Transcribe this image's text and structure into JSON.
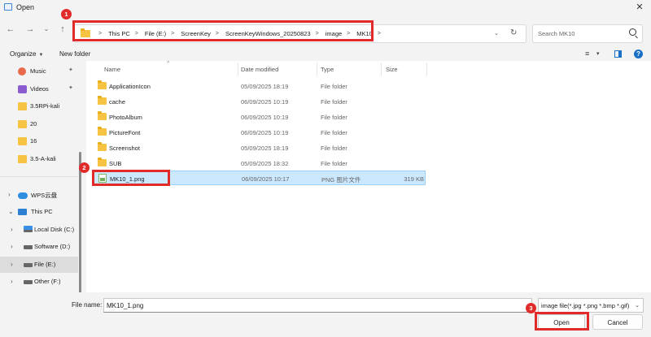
{
  "window": {
    "title": "Open",
    "close_glyph": "✕"
  },
  "nav": {
    "back_glyph": "←",
    "forward_glyph": "→",
    "dropdown_glyph": "⌄",
    "up_glyph": "↑",
    "breadcrumbs": [
      "This PC",
      "File (E:)",
      "ScreenKey",
      "ScreenKeyWindows_20250823",
      "image",
      "MK10"
    ],
    "address_dropdown_glyph": "⌄",
    "refresh_glyph": "↻",
    "search_placeholder": "Search MK10"
  },
  "command_bar": {
    "organize": "Organize",
    "new_folder": "New folder",
    "view_glyph": "≡",
    "view_caret": "▾",
    "help_glyph": "?"
  },
  "sidebar": {
    "items": [
      {
        "label": "Music",
        "icon": "music-icon",
        "pinned": true
      },
      {
        "label": "Videos",
        "icon": "videos-icon",
        "pinned": true
      },
      {
        "label": "3.5RPi-kali",
        "icon": "folder-icon"
      },
      {
        "label": "20",
        "icon": "folder-icon"
      },
      {
        "label": "16",
        "icon": "folder-icon"
      },
      {
        "label": "3.5-A-kali",
        "icon": "folder-icon"
      },
      {
        "label": "WPS云盘",
        "icon": "cloud-icon"
      },
      {
        "label": "This PC",
        "icon": "pc-icon"
      },
      {
        "label": "Local Disk (C:)",
        "icon": "drive-icon"
      },
      {
        "label": "Software (D:)",
        "icon": "drive-icon"
      },
      {
        "label": "File (E:)",
        "icon": "drive-icon"
      },
      {
        "label": "Other (F:)",
        "icon": "drive-icon"
      }
    ],
    "pin_glyph": "📌",
    "chevron_right": "›",
    "chevron_down": "⌄"
  },
  "columns": {
    "name": "Name",
    "date": "Date modified",
    "type": "Type",
    "size": "Size",
    "sort_glyph": "^"
  },
  "files": [
    {
      "name": "ApplicationIcon",
      "date": "05/09/2025 18:19",
      "type": "File folder",
      "size": ""
    },
    {
      "name": "cache",
      "date": "06/09/2025 10:19",
      "type": "File folder",
      "size": ""
    },
    {
      "name": "PhotoAlbum",
      "date": "06/09/2025 10:19",
      "type": "File folder",
      "size": ""
    },
    {
      "name": "PictureFont",
      "date": "06/09/2025 10:19",
      "type": "File folder",
      "size": ""
    },
    {
      "name": "Screenshot",
      "date": "05/09/2025 18:19",
      "type": "File folder",
      "size": ""
    },
    {
      "name": "SUB",
      "date": "05/09/2025 18:32",
      "type": "File folder",
      "size": ""
    },
    {
      "name": "MK10_1.png",
      "date": "06/09/2025 10:17",
      "type": "PNG 图片文件",
      "size": "319 KB"
    }
  ],
  "footer": {
    "file_name_label": "File name:",
    "file_name_value": "MK10_1.png",
    "filter_value": "image file(*.jpg *.png *.bmp *.gif)",
    "filter_caret": "⌄",
    "open_label": "Open",
    "cancel_label": "Cancel"
  },
  "annotations": [
    "1",
    "2",
    "3"
  ],
  "colors": {
    "annotation": "#e12a2a",
    "selection": "#cce8ff",
    "accent": "#1a6fc7"
  }
}
